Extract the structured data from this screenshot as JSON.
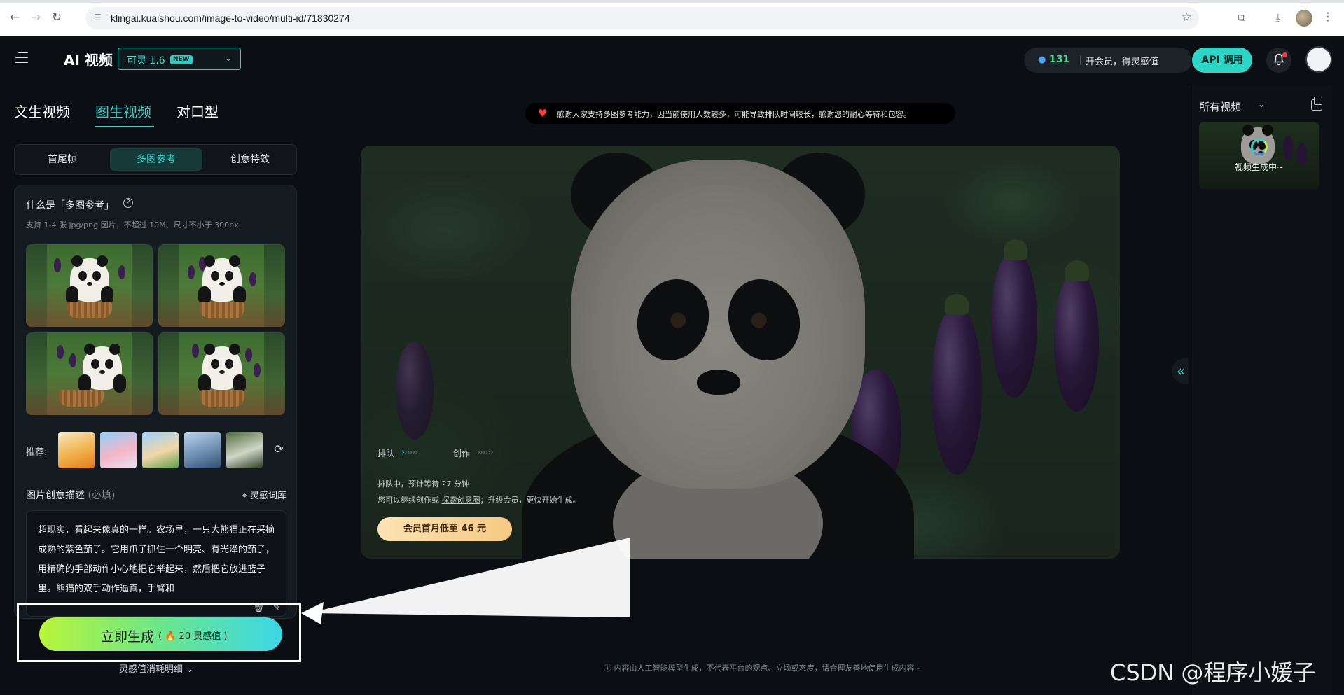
{
  "browser": {
    "url": "klingai.kuaishou.com/image-to-video/multi-id/71830274"
  },
  "header": {
    "app_title": "AI 视频",
    "model_name": "可灵 1.6",
    "model_badge": "NEW",
    "credits": "131",
    "member_cta": "开会员，得灵感值",
    "api_button": "API 调用"
  },
  "left": {
    "main_tabs": [
      {
        "label": "文生视频",
        "active": false
      },
      {
        "label": "图生视频",
        "active": true
      },
      {
        "label": "对口型",
        "active": false
      }
    ],
    "sub_tabs": [
      {
        "label": "首尾帧",
        "active": false
      },
      {
        "label": "多图参考",
        "active": true
      },
      {
        "label": "创意特效",
        "active": false
      }
    ],
    "card_title": "什么是「多图参考」",
    "card_help_icon": "?",
    "card_subtitle": "支持 1-4 张 jpg/png 图片，不超过 10M、尺寸不小于 300px",
    "recommend_label": "推荐:",
    "recommend_items": [
      "goldfish",
      "pig-character",
      "boy-character",
      "airplane",
      "woman-in-white"
    ],
    "desc_label": "图片创意描述",
    "desc_required": "(必填)",
    "desc_library": "灵感词库",
    "desc_text": "超现实，看起来像真的一样。农场里，一只大熊猫正在采摘成熟的紫色茄子。它用爪子抓住一个明亮、有光泽的茄子，用精确的手部动作小心地把它举起来，然后把它放进篮子里。熊猫的双手动作逼真，手臂和",
    "generate_label": "立即生成",
    "generate_cost": "20 灵感值",
    "cost_note": "灵感值消耗明细"
  },
  "center": {
    "notice": "感谢大家支持多图参考能力，因当前使用人数较多，可能导致排队时间较长，感谢您的耐心等待和包容。",
    "queue_step1": "排队",
    "queue_step2": "创作",
    "queue_status": "排队中，预计等待 27 分钟",
    "queue_hint_prefix": "您可以继续创作或",
    "queue_hint_link": "探索创意圈",
    "queue_hint_suffix": "；升级会员，更快开始生成。",
    "vip_button": "会员首月低至 46 元",
    "disclaimer": "内容由人工智能模型生成，不代表平台的观点、立场或态度，请合理友善地使用生成内容~"
  },
  "right": {
    "title": "所有视频",
    "generating_text": "视频生成中~"
  },
  "watermark": "CSDN @程序小媛子",
  "colors": {
    "accent": "#2fd3cb",
    "background": "#0b0e13",
    "credits_green": "#3ee08b",
    "vip_gold": "#f6c982"
  }
}
